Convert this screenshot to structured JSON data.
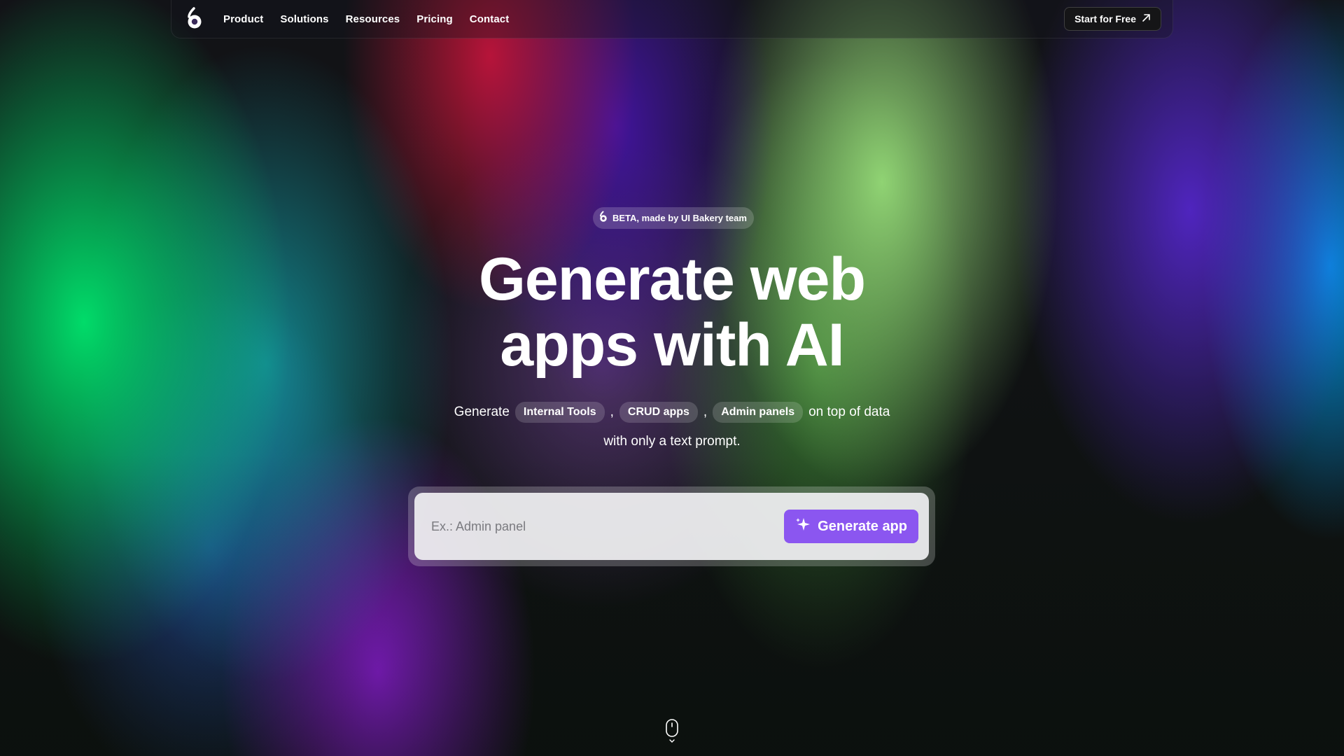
{
  "nav": {
    "logo_icon": "ui-bakery-logo-icon",
    "links": [
      "Product",
      "Solutions",
      "Resources",
      "Pricing",
      "Contact"
    ],
    "cta_label": "Start for Free",
    "cta_icon": "arrow-up-right-icon"
  },
  "hero": {
    "badge_label": "BETA, made by UI Bakery team",
    "title_line1": "Generate web",
    "title_line2": "apps with AI",
    "sub_prefix": "Generate",
    "chips": [
      "Internal Tools",
      "CRUD apps",
      "Admin panels"
    ],
    "separator": ",",
    "sub_suffix": "on top of data",
    "sub_line2": "with only a text prompt."
  },
  "prompt": {
    "placeholder": "Ex.: Admin panel",
    "button_label": "Generate app",
    "button_icon": "sparkle-icon"
  },
  "scroll": {
    "icon": "mouse-scroll-icon"
  },
  "colors": {
    "accent": "#8b56f0",
    "cta_bg": "#151517"
  }
}
